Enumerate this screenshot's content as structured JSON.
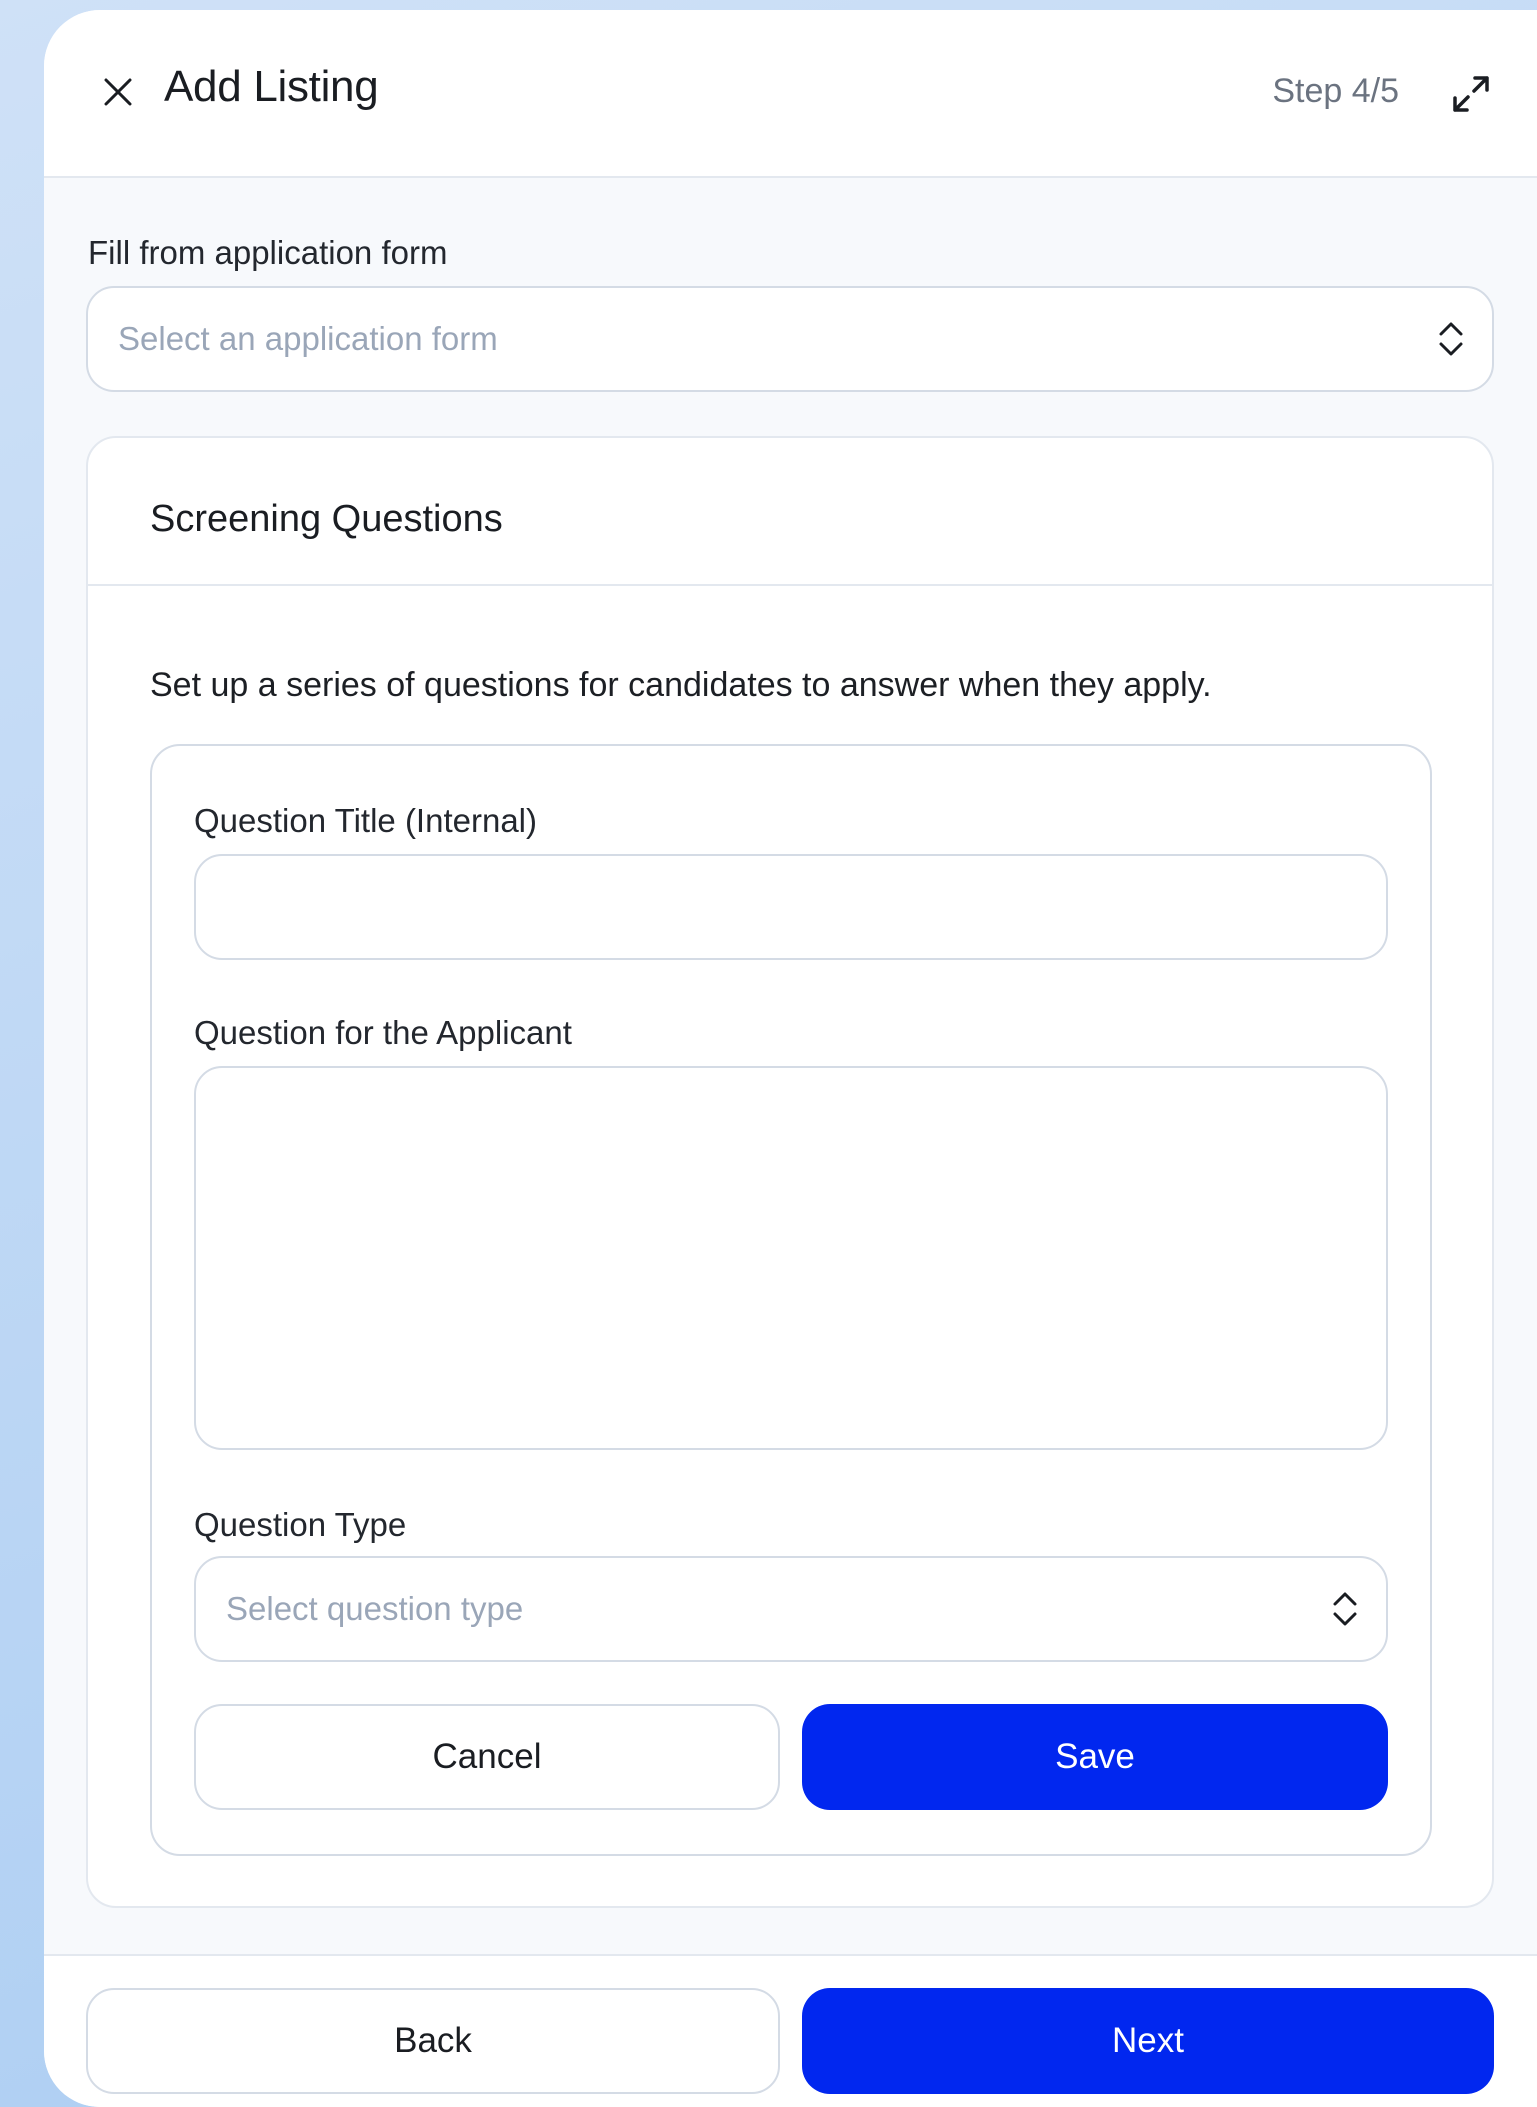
{
  "header": {
    "title": "Add Listing",
    "step": "Step 4/5"
  },
  "application_form": {
    "label": "Fill from application form",
    "placeholder": "Select an application form"
  },
  "screening": {
    "title": "Screening Questions",
    "description": "Set up a series of questions for candidates to answer when they apply.",
    "question_title_label": "Question Title (Internal)",
    "question_title_value": "",
    "question_applicant_label": "Question for the Applicant",
    "question_applicant_value": "",
    "question_type_label": "Question Type",
    "question_type_placeholder": "Select question type",
    "cancel_label": "Cancel",
    "save_label": "Save"
  },
  "footer": {
    "back_label": "Back",
    "next_label": "Next"
  },
  "colors": {
    "primary": "#0127ef",
    "border": "#d4dbe5",
    "placeholder": "#9aa6b8",
    "background": "#a9ccf2"
  },
  "icons": {
    "close": "close-icon",
    "expand": "expand-icon",
    "chevron": "chevron-up-down-icon"
  }
}
